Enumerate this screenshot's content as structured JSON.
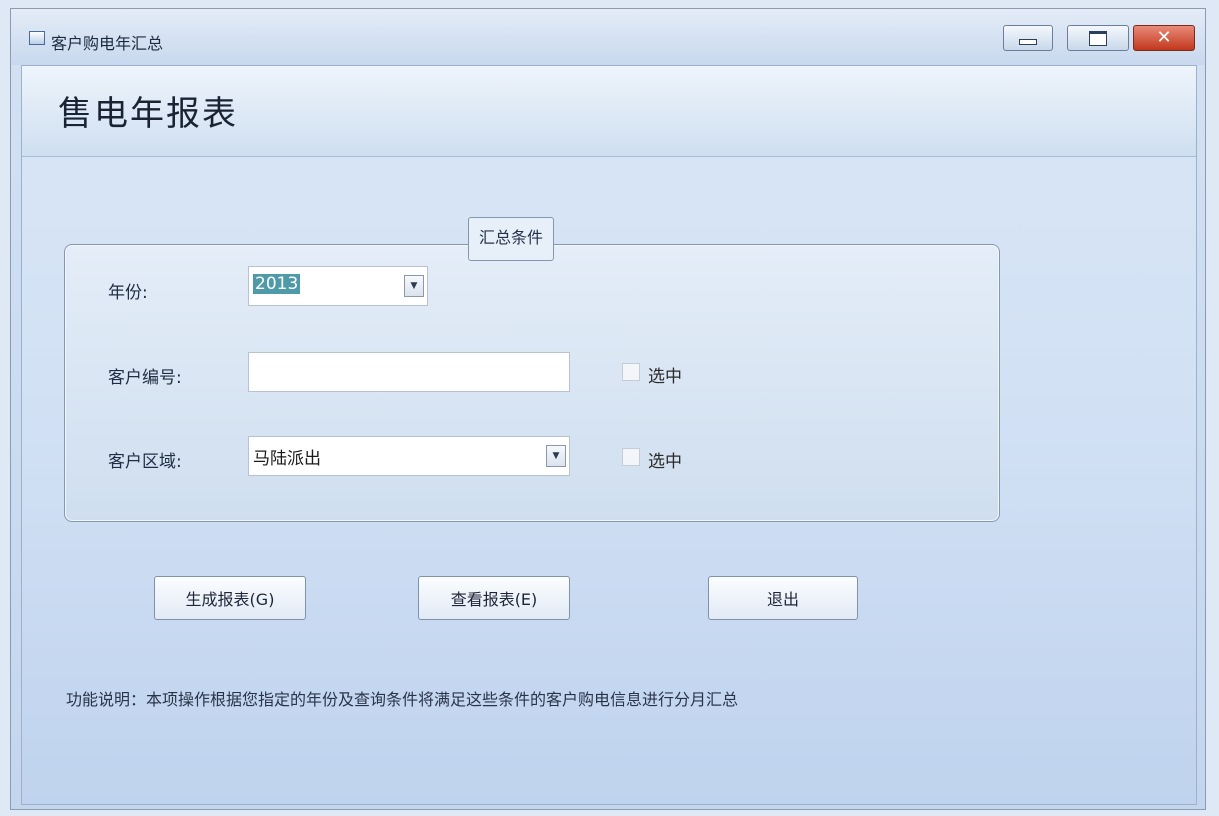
{
  "window": {
    "title": "客户购电年汇总",
    "controls": {
      "minimize_icon": "minimize-icon",
      "maximize_icon": "maximize-icon",
      "close_icon": "close-icon",
      "close_glyph": "✕"
    }
  },
  "page": {
    "title": "售电年报表"
  },
  "conditions": {
    "caption": "汇总条件",
    "year": {
      "label": "年份:",
      "value": "2013"
    },
    "customer_id": {
      "label": "客户编号:",
      "value": "",
      "checkbox_label": "选中",
      "checked": false
    },
    "customer_area": {
      "label": "客户区域:",
      "value": "马陆派出",
      "checkbox_label": "选中",
      "checked": false
    }
  },
  "buttons": {
    "generate": "生成报表(G)",
    "view": "查看报表(E)",
    "exit": "退出"
  },
  "description": "功能说明：本项操作根据您指定的年份及查询条件将满足这些条件的客户购电信息进行分月汇总",
  "colors": {
    "close_button": "#c2371d",
    "selection": "#4e9aa8",
    "window_bg": "#d3e1f3"
  }
}
